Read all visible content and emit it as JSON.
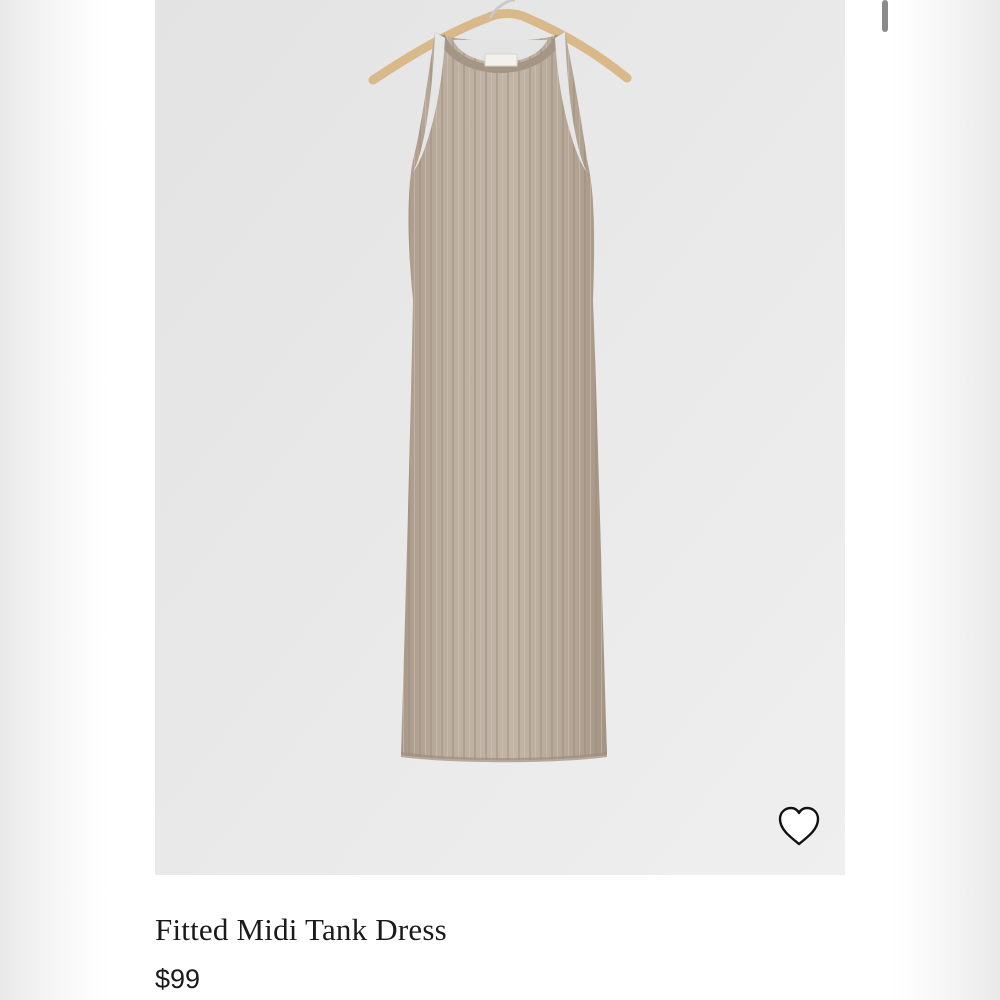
{
  "product": {
    "title": "Fitted Midi Tank Dress",
    "price": "$99",
    "image_alt": "Fitted Midi Tank Dress",
    "dress_color": "#b9aa9c",
    "favorite_icon": "heart-outline-icon"
  }
}
